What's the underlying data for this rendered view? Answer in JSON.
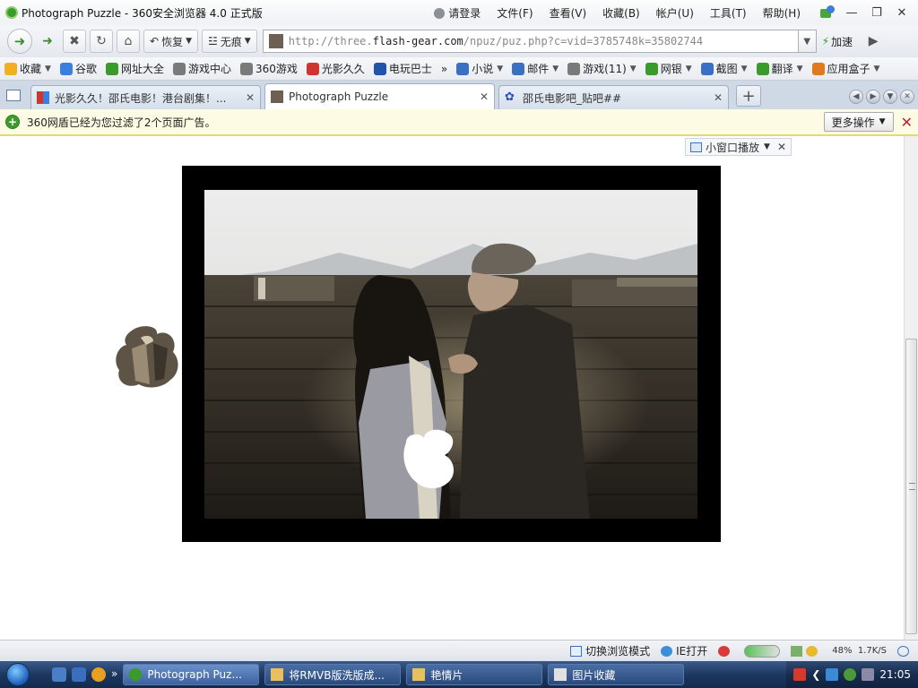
{
  "window": {
    "title": "Photograph Puzzle - 360安全浏览器 4.0 正式版",
    "menu": [
      "请登录",
      "文件(F)",
      "查看(V)",
      "收藏(B)",
      "帐户(U)",
      "工具(T)",
      "帮助(H)"
    ],
    "skin_badge": "5"
  },
  "nav": {
    "restore_label": "恢复",
    "trace_label": "无痕",
    "url_prefix": "http://three.",
    "url_domain": "flash-gear.com",
    "url_path": "/npuz/puz.php?c=vid=3785748k=35802744",
    "speed_label": "加速"
  },
  "bookmarks": [
    {
      "label": "收藏",
      "caret": true,
      "color": "#f0b020"
    },
    {
      "label": "谷歌",
      "caret": false,
      "color": "#3a7ee0"
    },
    {
      "label": "网址大全",
      "caret": false,
      "color": "#3a9a2a"
    },
    {
      "label": "游戏中心",
      "caret": false,
      "color": "#7a7a7a"
    },
    {
      "label": "360游戏",
      "caret": false,
      "color": "#7a7a7a"
    },
    {
      "label": "光影久久",
      "caret": false,
      "color": "#d0342c"
    },
    {
      "label": "电玩巴士",
      "caret": false,
      "color": "#2255aa"
    },
    {
      "label": "»",
      "caret": false,
      "color": ""
    },
    {
      "label": "小说",
      "caret": true,
      "color": "#3b6fc2"
    },
    {
      "label": "邮件",
      "caret": true,
      "color": "#3b6fc2"
    },
    {
      "label": "游戏(11)",
      "caret": true,
      "color": "#7a7a7a"
    },
    {
      "label": "网银",
      "caret": true,
      "color": "#3a9a2a"
    },
    {
      "label": "截图",
      "caret": true,
      "color": "#3b6fc2"
    },
    {
      "label": "翻译",
      "caret": true,
      "color": "#3a9a2a"
    },
    {
      "label": "应用盒子",
      "caret": true,
      "color": "#e07a20"
    }
  ],
  "tabs": [
    {
      "label": "光影久久！邵氏电影！港台剧集！...",
      "active": false
    },
    {
      "label": "Photograph Puzzle",
      "active": true
    },
    {
      "label": "邵氏电影吧_贴吧##",
      "active": false
    }
  ],
  "notice": {
    "text": "360网盾已经为您过滤了2个页面广告。",
    "more_label": "更多操作"
  },
  "content": {
    "mini_window_label": "小窗口播放"
  },
  "statusbar": {
    "switch_mode": "切换浏览模式",
    "ie_open": "IE打开",
    "speed_down": "1.7K/S",
    "percent": "48%"
  },
  "taskbar": {
    "tasks": [
      {
        "label": "Photograph Puz...",
        "active": true
      },
      {
        "label": "将RMVB版洗版成...",
        "active": false
      },
      {
        "label": "艳情片",
        "active": false
      },
      {
        "label": "图片收藏",
        "active": false
      }
    ],
    "clock": "21:05"
  },
  "colors": {
    "accent_green": "#3a9a2a",
    "notice_bg": "#fdfbe3",
    "tabbar_bg": "#cfd9e6"
  }
}
